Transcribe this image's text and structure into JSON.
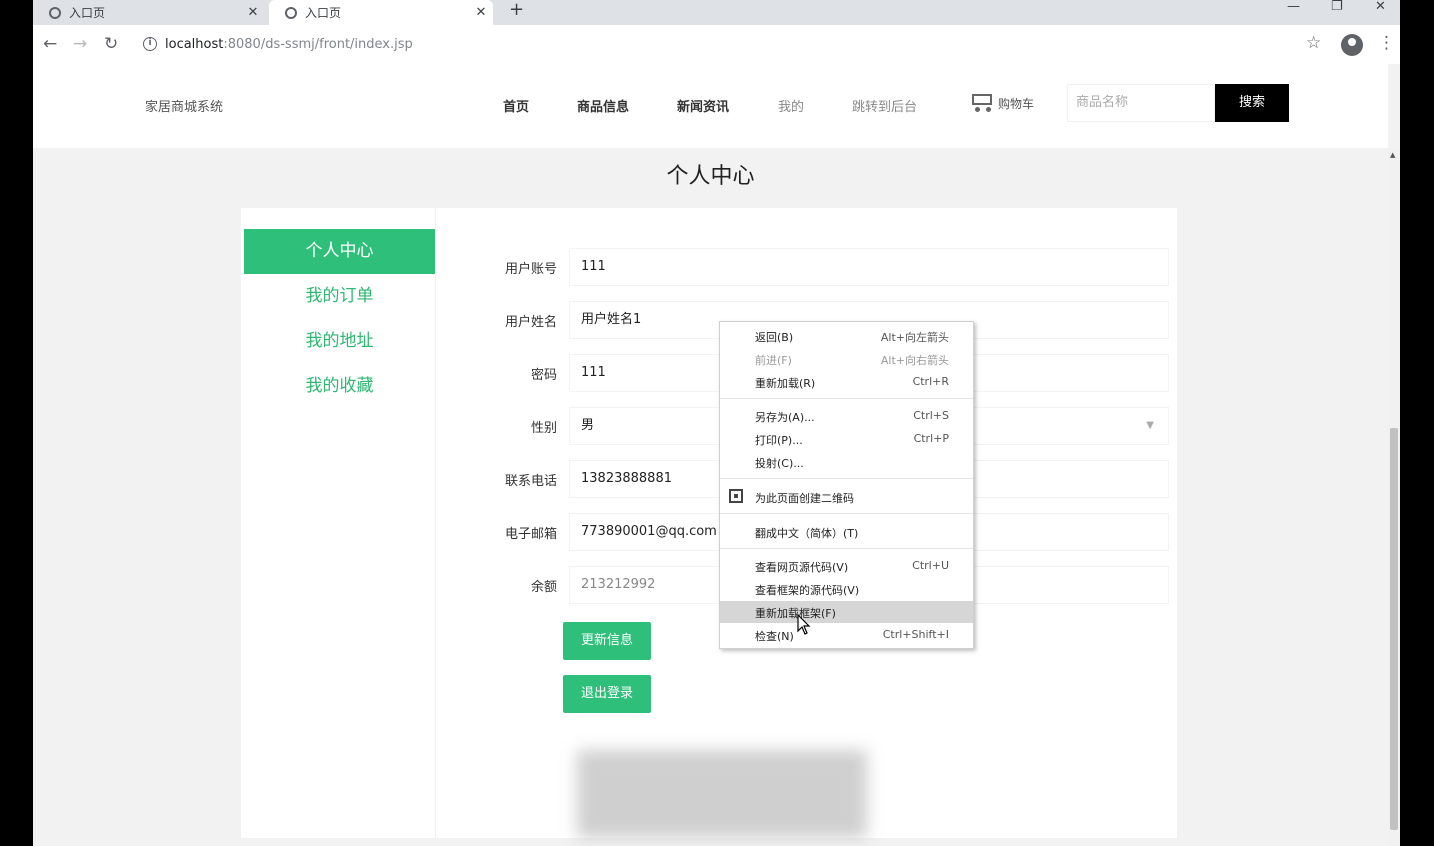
{
  "browser": {
    "tabs": [
      {
        "title": "入口页",
        "active": false
      },
      {
        "title": "入口页",
        "active": true
      }
    ],
    "new_tab": "+",
    "window_controls": {
      "minimize": "—",
      "restore": "❐",
      "close": "✕"
    },
    "url_host": "localhost",
    "url_rest": ":8080/ds-ssmj/front/index.jsp"
  },
  "site": {
    "title": "家居商城系统",
    "nav": [
      "首页",
      "商品信息",
      "新闻资讯",
      "我的",
      "跳转到后台"
    ],
    "cart_label": "购物车",
    "search_placeholder": "商品名称",
    "search_button": "搜索"
  },
  "page": {
    "title": "个人中心",
    "side_menu": [
      "个人中心",
      "我的订单",
      "我的地址",
      "我的收藏"
    ],
    "form": [
      {
        "label": "用户账号",
        "value": "111"
      },
      {
        "label": "用户姓名",
        "value": "用户姓名1"
      },
      {
        "label": "密码",
        "value": "111"
      },
      {
        "label": "性别",
        "value": "男"
      },
      {
        "label": "联系电话",
        "value": "13823888881"
      },
      {
        "label": "电子邮箱",
        "value": "773890001@qq.com"
      },
      {
        "label": "余额",
        "value": "213212992"
      }
    ],
    "update_button": "更新信息",
    "logout_button": "退出登录"
  },
  "context_menu": {
    "items": [
      {
        "label": "返回(B)",
        "shortcut": "Alt+向左箭头"
      },
      {
        "label": "前进(F)",
        "shortcut": "Alt+向右箭头",
        "disabled": true
      },
      {
        "label": "重新加载(R)",
        "shortcut": "Ctrl+R"
      },
      {
        "label": "另存为(A)...",
        "shortcut": "Ctrl+S"
      },
      {
        "label": "打印(P)...",
        "shortcut": "Ctrl+P"
      },
      {
        "label": "投射(C)...",
        "shortcut": ""
      },
      {
        "label": "为此页面创建二维码",
        "shortcut": ""
      },
      {
        "label": "翻成中文（简体）(T)",
        "shortcut": ""
      },
      {
        "label": "查看网页源代码(V)",
        "shortcut": "Ctrl+U"
      },
      {
        "label": "查看框架的源代码(V)",
        "shortcut": ""
      },
      {
        "label": "重新加载框架(F)",
        "shortcut": "",
        "highlighted": true
      },
      {
        "label": "检查(N)",
        "shortcut": "Ctrl+Shift+I"
      }
    ]
  }
}
